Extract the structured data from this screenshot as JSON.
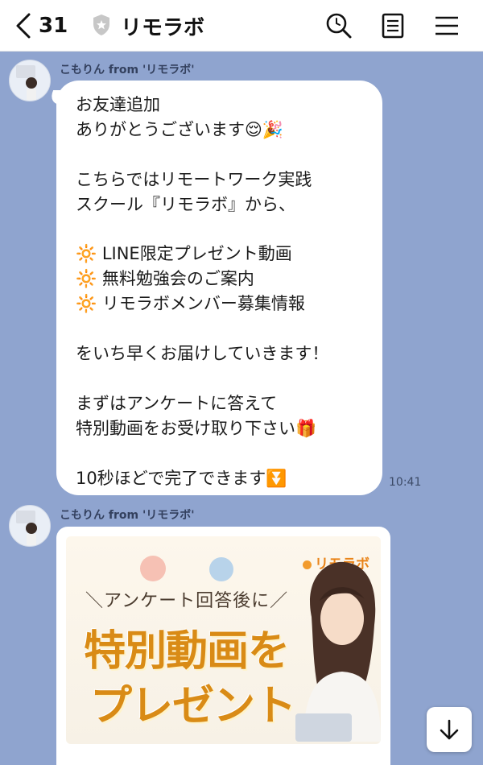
{
  "header": {
    "unread_count": "31",
    "title": "リモラボ"
  },
  "messages": [
    {
      "sender": "こもりん from 'リモラボ'",
      "text": "お友達追加\nありがとうございます😌🎉\n\nこちらではリモートワーク実践\nスクール『リモラボ』から、\n\n🔆 LINE限定プレゼント動画\n🔆 無料勉強会のご案内\n🔆 リモラボメンバー募集情報\n\nをいち早くお届けしていきます！\n\nまずはアンケートに答えて\n特別動画をお受け取り下さい🎁\n\n10秒ほどで完了できます⏬",
      "time": "10:41"
    },
    {
      "sender": "こもりん from 'リモラボ'"
    }
  ],
  "banner": {
    "brand": "リモラボ",
    "subtitle": "＼アンケート回答後に／",
    "line1": "特別動画を",
    "line2": "プレゼント"
  },
  "colors": {
    "chat_background": "#8fa4cf",
    "bubble": "#ffffff",
    "banner_gold": "#d98b16"
  },
  "icons": [
    "back-chevron-icon",
    "shield-icon",
    "search-icon",
    "notes-icon",
    "menu-icon",
    "arrow-down-icon"
  ]
}
